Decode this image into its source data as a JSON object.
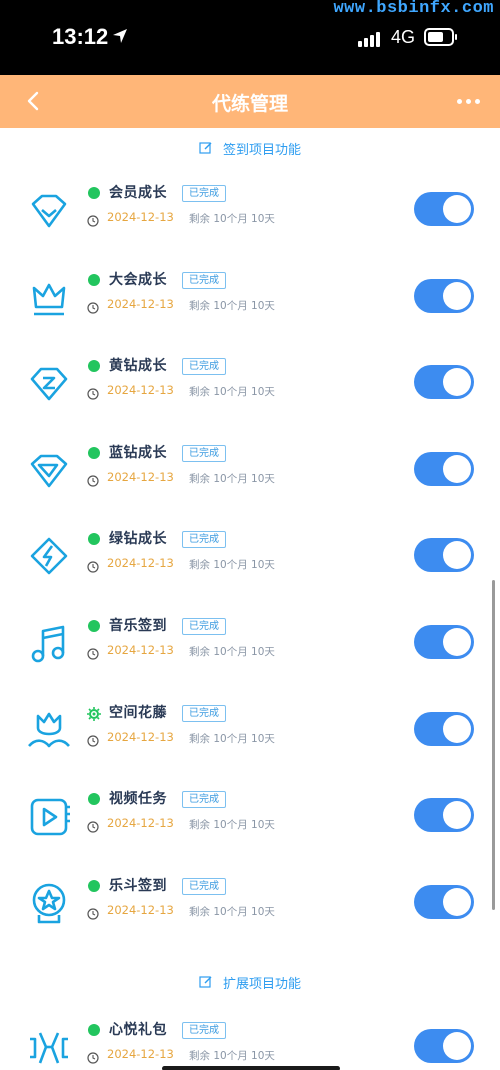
{
  "status_bar": {
    "time": "13:12",
    "network": "4G",
    "battery_level": 0.7,
    "watermark": "www.bsbinfx.com"
  },
  "navbar": {
    "title": "代练管理"
  },
  "section1": {
    "title": "签到项目功能"
  },
  "items": [
    {
      "icon": "diamond-gem-icon",
      "name": "会员成长",
      "status_icon": "green-dot",
      "badge": "已完成",
      "date": "2024-12-13",
      "remaining": "剩余 10个月 10天",
      "enabled": true
    },
    {
      "icon": "crown-icon",
      "name": "大会成长",
      "status_icon": "green-dot",
      "badge": "已完成",
      "date": "2024-12-13",
      "remaining": "剩余 10个月 10天",
      "enabled": true
    },
    {
      "icon": "yellow-diamond-icon",
      "name": "黄钻成长",
      "status_icon": "green-dot",
      "badge": "已完成",
      "date": "2024-12-13",
      "remaining": "剩余 10个月 10天",
      "enabled": true
    },
    {
      "icon": "blue-diamond-icon",
      "name": "蓝钻成长",
      "status_icon": "green-dot",
      "badge": "已完成",
      "date": "2024-12-13",
      "remaining": "剩余 10个月 10天",
      "enabled": true
    },
    {
      "icon": "green-diamond-icon",
      "name": "绿钻成长",
      "status_icon": "green-dot",
      "badge": "已完成",
      "date": "2024-12-13",
      "remaining": "剩余 10个月 10天",
      "enabled": true
    },
    {
      "icon": "music-note-icon",
      "name": "音乐签到",
      "status_icon": "green-dot",
      "badge": "已完成",
      "date": "2024-12-13",
      "remaining": "剩余 10个月 10天",
      "enabled": true
    },
    {
      "icon": "flower-icon",
      "name": "空间花藤",
      "status_icon": "gear",
      "badge": "已完成",
      "date": "2024-12-13",
      "remaining": "剩余 10个月 10天",
      "enabled": true
    },
    {
      "icon": "video-play-icon",
      "name": "视频任务",
      "status_icon": "green-dot",
      "badge": "已完成",
      "date": "2024-12-13",
      "remaining": "剩余 10个月 10天",
      "enabled": true
    },
    {
      "icon": "star-badge-icon",
      "name": "乐斗签到",
      "status_icon": "green-dot",
      "badge": "已完成",
      "date": "2024-12-13",
      "remaining": "剩余 10个月 10天",
      "enabled": true
    }
  ],
  "section2": {
    "title": "扩展项目功能"
  },
  "items2": [
    {
      "icon": "heart-gift-icon",
      "name": "心悦礼包",
      "status_icon": "green-dot",
      "badge": "已完成",
      "date": "2024-12-13",
      "remaining": "剩余 10个月 10天",
      "enabled": true
    }
  ],
  "colors": {
    "navbar": "#ffb678",
    "accent": "#2e9df0",
    "toggle_on": "#3d8cf0",
    "date": "#e6a640",
    "status_ok": "#22c55e"
  }
}
